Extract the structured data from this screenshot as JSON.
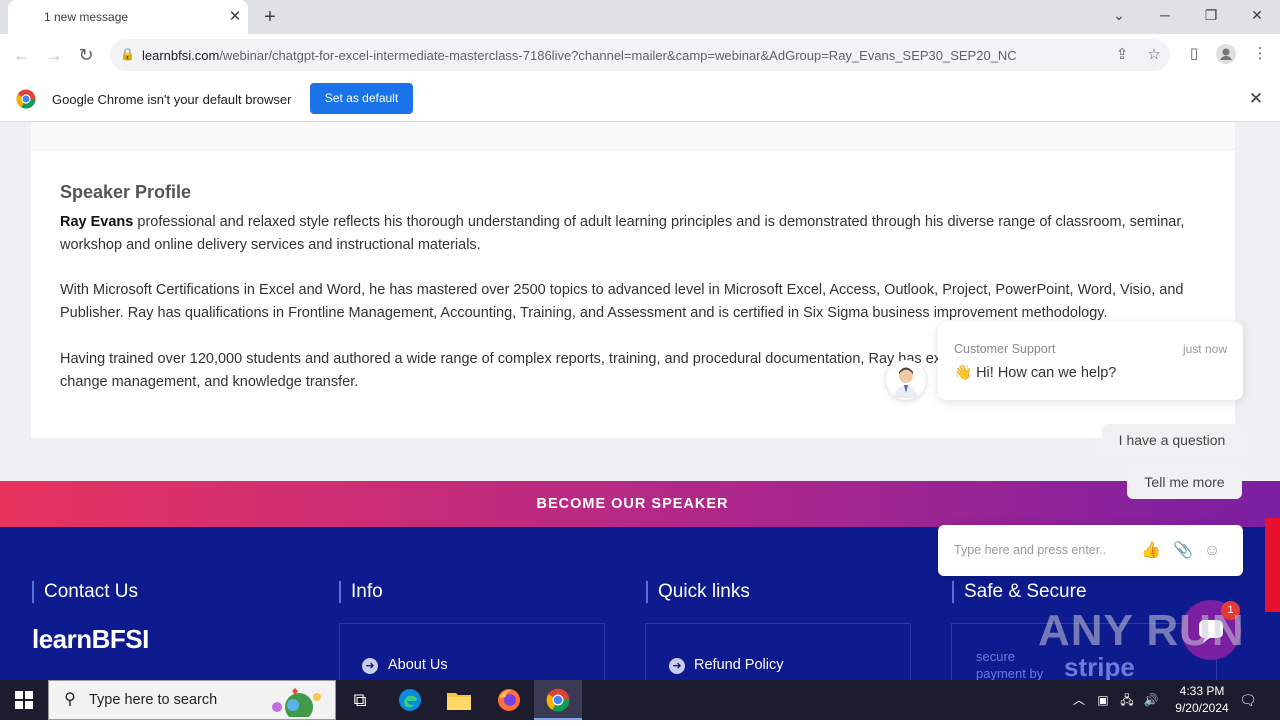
{
  "browser": {
    "tab_title": "1 new message",
    "url_host": "learnbfsi.com",
    "url_path": "/webinar/chatgpt-for-excel-intermediate-masterclass-7186live?channel=mailer&camp=webinar&AdGroup=Ray_Evans_SEP30_SEP20_NC",
    "infobar_text": "Google Chrome isn't your default browser",
    "set_default_label": "Set as default"
  },
  "speaker": {
    "heading": "Speaker Profile",
    "name": "Ray Evans",
    "para1_rest": " professional and relaxed style reflects his thorough understanding of adult learning principles and is demonstrated through his diverse range of classroom, seminar, workshop and online delivery services and instructional materials.",
    "para2": "With Microsoft Certifications in Excel and Word, he has mastered over 2500 topics to advanced level in Microsoft Excel, Access, Outlook, Project, PowerPoint, Word, Visio, and Publisher. Ray has qualifications in Frontline Management, Accounting, Training, and Assessment and is certified in Six Sigma business improvement methodology.",
    "para3": "Having trained over 120,000 students and authored a wide range of complex reports, training, and procedural documentation, Ray has expertise in business communication, change management, and knowledge transfer."
  },
  "banner": {
    "label": "BECOME OUR SPEAKER"
  },
  "footer": {
    "contact_title": "Contact Us",
    "info_title": "Info",
    "quick_links_title": "Quick links",
    "secure_title": "Safe & Secure",
    "logo": "learnBFSI",
    "about_link": "About Us",
    "refund_link": "Refund Policy",
    "secure_text": "secure\npayment by",
    "stripe": "stripe"
  },
  "chat": {
    "agent": "Customer Support",
    "time": "just now",
    "message": "👋 Hi! How can we help?",
    "quick_replies": [
      "I have a question",
      "Tell me more"
    ],
    "input_placeholder": "Type here and press enter..",
    "badge_count": "1"
  },
  "watermark": "ANY RUN",
  "taskbar": {
    "search_placeholder": "Type here to search",
    "time": "4:33 PM",
    "date": "9/20/2024"
  },
  "colors": {
    "chrome_blue": "#1a73e8",
    "footer_navy": "#0d1b8f",
    "banner_pink": "#e8335f",
    "banner_purple": "#7b1fa2"
  }
}
